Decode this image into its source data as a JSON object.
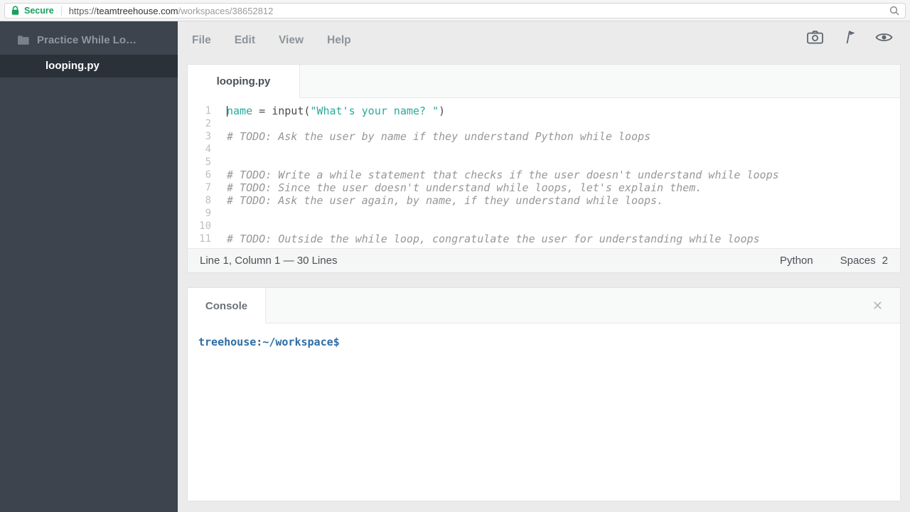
{
  "browser": {
    "secure_label": "Secure",
    "url": {
      "scheme": "https://",
      "host": "teamtreehouse.com",
      "path": "/workspaces/38652812"
    }
  },
  "sidebar": {
    "project_name": "Practice While Lo…",
    "file_name": "looping.py"
  },
  "menubar": {
    "items": [
      "File",
      "Edit",
      "View",
      "Help"
    ],
    "icons": [
      "camera-icon",
      "flag-icon",
      "eye-icon"
    ]
  },
  "editor": {
    "tab_label": "looping.py",
    "lines": [
      {
        "num": 1,
        "cursor": true,
        "segments": [
          {
            "c": "teal",
            "t": "name"
          },
          {
            "c": "plain",
            "t": " = input("
          },
          {
            "c": "teal",
            "t": "\"What's your name? \""
          },
          {
            "c": "plain",
            "t": ")"
          }
        ]
      },
      {
        "num": 2,
        "segments": []
      },
      {
        "num": 3,
        "segments": [
          {
            "c": "comment",
            "t": "# TODO: Ask the user by name if they understand Python while loops"
          }
        ]
      },
      {
        "num": 4,
        "segments": []
      },
      {
        "num": 5,
        "segments": []
      },
      {
        "num": 6,
        "segments": [
          {
            "c": "comment",
            "t": "# TODO: Write a while statement that checks if the user doesn't understand while loops"
          }
        ]
      },
      {
        "num": 7,
        "segments": [
          {
            "c": "comment",
            "t": "# TODO: Since the user doesn't understand while loops, let's explain them."
          }
        ]
      },
      {
        "num": 8,
        "segments": [
          {
            "c": "comment",
            "t": "# TODO: Ask the user again, by name, if they understand while loops."
          }
        ]
      },
      {
        "num": 9,
        "segments": []
      },
      {
        "num": 10,
        "segments": []
      },
      {
        "num": 11,
        "segments": [
          {
            "c": "comment",
            "t": "# TODO: Outside the while loop, congratulate the user for understanding while loops"
          }
        ]
      }
    ],
    "statusbar": {
      "position": "Line 1, Column 1 — 30 Lines",
      "language": "Python",
      "indent_label": "Spaces",
      "indent_value": "2"
    }
  },
  "console": {
    "tab_label": "Console",
    "prompt": "treehouse:~/workspace$",
    "close_glyph": "✕"
  },
  "colors": {
    "secure_green": "#16a05d",
    "accent_teal": "#2aa99a",
    "sidebar_bg": "#3d444d",
    "sidebar_active_bg": "#2b3139",
    "prompt_blue": "#2e6ca5"
  }
}
